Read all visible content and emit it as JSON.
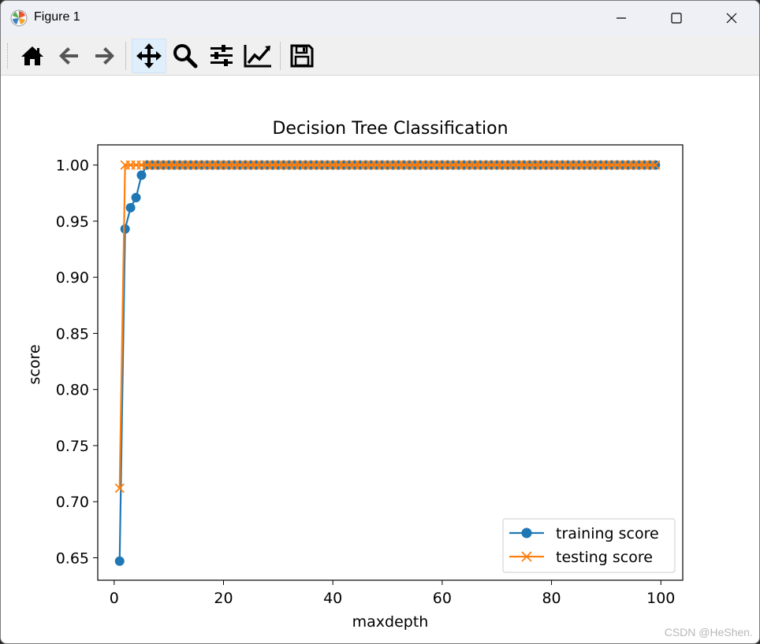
{
  "window": {
    "title": "Figure 1"
  },
  "toolbar": {
    "buttons": [
      {
        "icon": "home-icon"
      },
      {
        "icon": "back-arrow-icon"
      },
      {
        "icon": "forward-arrow-icon"
      },
      {
        "icon": "pan-move-icon",
        "active": true
      },
      {
        "icon": "zoom-magnifier-icon"
      },
      {
        "icon": "configure-subplots-icon"
      },
      {
        "icon": "edit-axis-icon"
      },
      {
        "icon": "save-floppy-icon"
      }
    ]
  },
  "chart_data": {
    "type": "line",
    "title": "Decision Tree Classification",
    "xlabel": "maxdepth",
    "ylabel": "score",
    "xlim": [
      -3,
      104
    ],
    "ylim": [
      0.63,
      1.018
    ],
    "xticks": [
      "0",
      "20",
      "40",
      "60",
      "80",
      "100"
    ],
    "yticks": [
      "0.65",
      "0.70",
      "0.75",
      "0.80",
      "0.85",
      "0.90",
      "0.95",
      "1.00"
    ],
    "legend_position": "lower-right",
    "series": [
      {
        "name": "training score",
        "color": "#1f77b4",
        "marker": "circle",
        "x_start": 1,
        "x_end": 99,
        "first_values": [
          0.647,
          0.943,
          0.962,
          0.971,
          0.991
        ],
        "remaining_value": 1.0
      },
      {
        "name": "testing score",
        "color": "#ff7f0e",
        "marker": "x",
        "x_start": 1,
        "x_end": 99,
        "first_values": [
          0.712
        ],
        "remaining_value": 1.0
      }
    ]
  },
  "watermark": "CSDN @HeShen."
}
